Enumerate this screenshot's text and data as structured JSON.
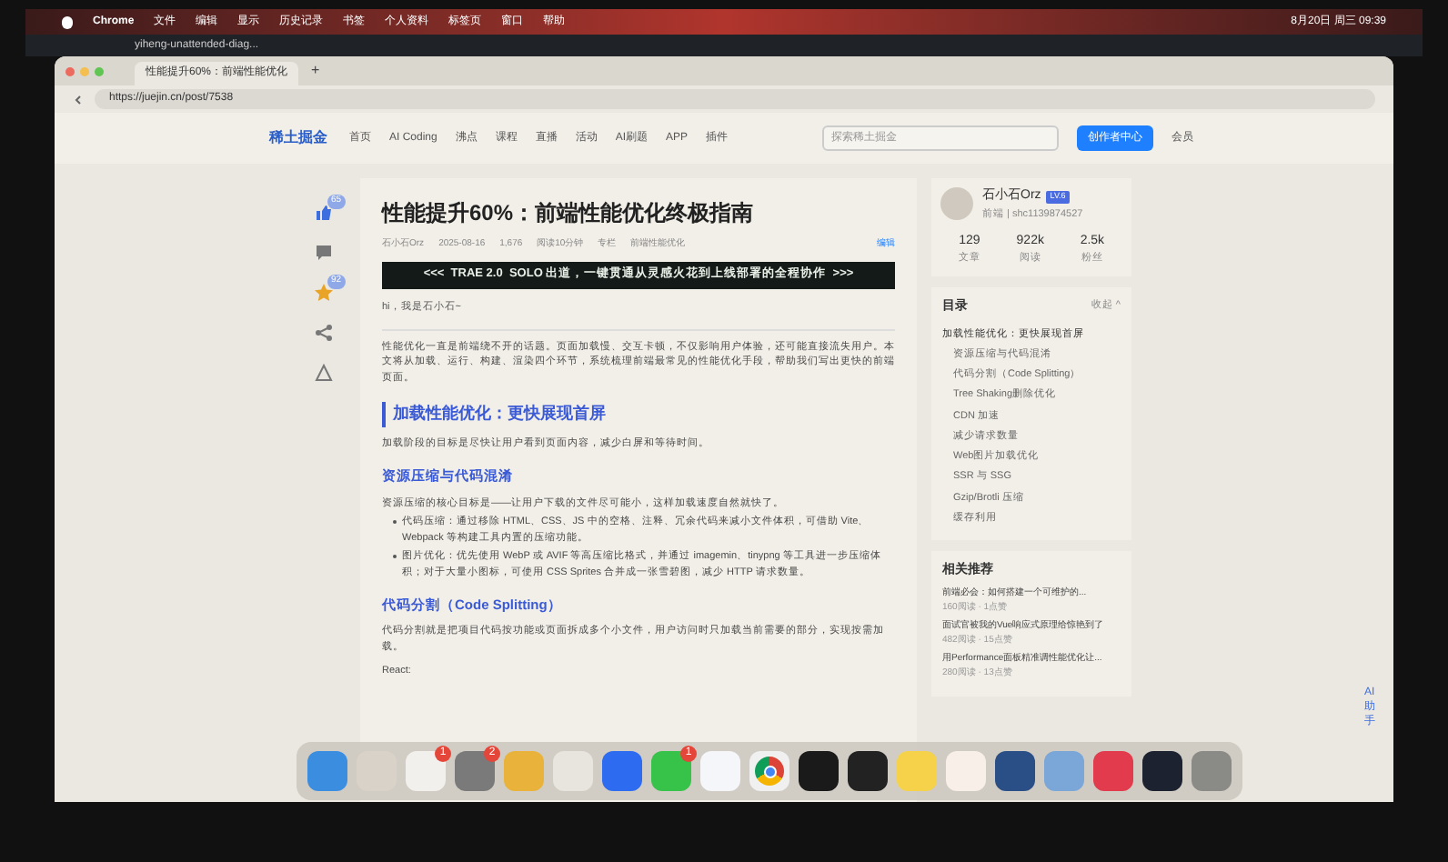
{
  "menu_bar": {
    "app": "Chrome",
    "items": [
      "文件",
      "编辑",
      "显示",
      "历史记录",
      "书签",
      "个人资料",
      "标签页",
      "窗口",
      "帮助"
    ],
    "clock": "8月20日 周三 09:39"
  },
  "back_window": {
    "title": "yiheng-unattended-diag..."
  },
  "browser": {
    "tab": "性能提升60%：前端性能优化",
    "new_tab": "+",
    "url": "https://juejin.cn/post/7538"
  },
  "site_nav": {
    "logo": "稀土掘金",
    "items": [
      {
        "label": "首页",
        "selected": false
      },
      {
        "label": "AI Coding",
        "selected": false
      },
      {
        "label": "沸点",
        "selected": false
      },
      {
        "label": "课程",
        "selected": false
      },
      {
        "label": "直播",
        "selected": false
      },
      {
        "label": "活动",
        "selected": false
      },
      {
        "label": "AI刷题",
        "selected": false
      },
      {
        "label": "APP",
        "selected": false
      },
      {
        "label": "插件",
        "selected": false
      }
    ],
    "search": {
      "placeholder": "探索稀土掘金"
    },
    "creator_button": "创作者中心",
    "member": "会员"
  },
  "actions": [
    {
      "kind": "like",
      "count": "65"
    },
    {
      "kind": "comment"
    },
    {
      "kind": "star",
      "count": "92"
    },
    {
      "kind": "share"
    },
    {
      "kind": "report"
    }
  ],
  "article": {
    "title": "性能提升60%：前端性能优化终极指南",
    "meta": [
      "石小石Orz",
      "2025-08-16",
      "1,676",
      "阅读10分钟",
      "专栏",
      "前端性能优化"
    ],
    "edit": "编辑",
    "banner": "<<<  TRAE 2.0  SOLO 出道，一键贯通从灵感火花到上线部署的全程协作  >>>",
    "greeting": "hi，我是石小石~",
    "blocks": [
      {
        "kind": "p",
        "text": "性能优化一直是前端绕不开的话题。页面加载慢、交互卡顿，不仅影响用户体验，还可能直接流失用户。本文将从加载、运行、构建、渲染四个环节，系统梳理前端最常见的性能优化手段，帮助我们写出更快的前端页面。"
      },
      {
        "kind": "h2",
        "text": "加载性能优化：更快展现首屏"
      },
      {
        "kind": "p",
        "text": "加载阶段的目标是尽快让用户看到页面内容，减少白屏和等待时间。"
      },
      {
        "kind": "h3",
        "text": "资源压缩与代码混淆"
      },
      {
        "kind": "p",
        "text": "资源压缩的核心目标是——让用户下载的文件尽可能小，这样加载速度自然就快了。"
      },
      {
        "kind": "li",
        "text": "代码压缩：通过移除 HTML、CSS、JS 中的空格、注释、冗余代码来减小文件体积，可借助 Vite、Webpack 等构建工具内置的压缩功能。"
      },
      {
        "kind": "li",
        "text": "图片优化：优先使用 WebP 或 AVIF 等高压缩比格式，并通过 imagemin、tinypng 等工具进一步压缩体积；对于大量小图标，可使用 CSS Sprites 合并成一张雪碧图，减少 HTTP 请求数量。"
      },
      {
        "kind": "h3",
        "text": "代码分割（Code Splitting）"
      },
      {
        "kind": "p",
        "text": "代码分割就是把项目代码按功能或页面拆成多个小文件，用户访问时只加载当前需要的部分，实现按需加载。"
      },
      {
        "kind": "p",
        "text": "React:"
      }
    ]
  },
  "author": {
    "name": "石小石Orz",
    "level": "LV.6",
    "bio": "前端 | shc1139874527",
    "stats": [
      {
        "value": "129",
        "label": "文章"
      },
      {
        "value": "922k",
        "label": "阅读"
      },
      {
        "value": "2.5k",
        "label": "粉丝"
      }
    ]
  },
  "toc": {
    "title": "目录",
    "toggle": "收起 ^",
    "items": [
      {
        "label": "加载性能优化：更快展现首屏",
        "selected": true,
        "children": [
          {
            "label": "资源压缩与代码混淆",
            "selected": false
          },
          {
            "label": "代码分割（Code Splitting）",
            "selected": false
          },
          {
            "label": "Tree Shaking删除优化",
            "selected": false
          },
          {
            "label": "CDN 加速",
            "selected": false
          },
          {
            "label": "减少请求数量",
            "selected": false
          },
          {
            "label": "Web图片加载优化",
            "selected": false
          },
          {
            "label": "SSR 与 SSG",
            "selected": false
          },
          {
            "label": "Gzip/Brotli 压缩",
            "selected": false
          },
          {
            "label": "缓存利用",
            "selected": false
          }
        ]
      }
    ]
  },
  "related": {
    "title": "相关推荐",
    "items": [
      {
        "title": "前端必会：如何搭建一个可维护的...",
        "stats": "160阅读 · 1点赞"
      },
      {
        "title": "面试官被我的Vue响应式原理给惊艳到了",
        "stats": "482阅读 · 15点赞"
      },
      {
        "title": "用Performance面板精准调性能优化让...",
        "stats": "280阅读 · 13点赞"
      }
    ]
  },
  "assistant": "AI助手",
  "dock": [
    {
      "kind": "finder"
    },
    {
      "kind": "launchpad"
    },
    {
      "kind": "reminders",
      "badge": "1"
    },
    {
      "kind": "settings",
      "badge": "2"
    },
    {
      "kind": "tiles"
    },
    {
      "kind": "recorder"
    },
    {
      "kind": "lark"
    },
    {
      "kind": "wechat",
      "badge": "1"
    },
    {
      "kind": "vscode"
    },
    {
      "kind": "chrome"
    },
    {
      "kind": "battery"
    },
    {
      "kind": "terminal"
    },
    {
      "kind": "notes"
    },
    {
      "kind": "wps"
    },
    {
      "kind": "quicktime"
    },
    {
      "kind": "preview"
    },
    {
      "kind": "lala"
    },
    {
      "kind": "window"
    },
    {
      "kind": "trash"
    }
  ]
}
